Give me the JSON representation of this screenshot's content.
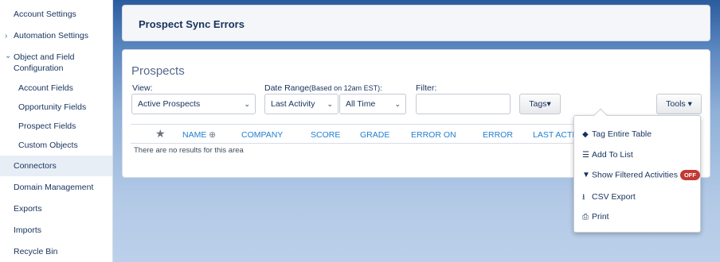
{
  "sidebar": {
    "items": [
      {
        "label": "Account Settings",
        "chevron": ""
      },
      {
        "label": "Automation Settings",
        "chevron": "›"
      },
      {
        "label": "Object and Field",
        "label2": "Configuration",
        "chevron": "⌄"
      },
      {
        "label": "Account Fields"
      },
      {
        "label": "Opportunity Fields"
      },
      {
        "label": "Prospect Fields"
      },
      {
        "label": "Custom Objects"
      },
      {
        "label": "Connectors"
      },
      {
        "label": "Domain Management"
      },
      {
        "label": "Exports"
      },
      {
        "label": "Imports"
      },
      {
        "label": "Recycle Bin"
      }
    ]
  },
  "header": {
    "title": "Prospect Sync Errors"
  },
  "prospects": {
    "title": "Prospects",
    "view_label": "View:",
    "view_value": "Active Prospects",
    "date_range_label": "Date Range",
    "date_range_note": "(Based on 12am EST):",
    "date_field": "Last Activity",
    "date_period": "All Time",
    "filter_label": "Filter:",
    "filter_value": "",
    "tags_button": "Tags▾",
    "tools_button": "Tools ▾"
  },
  "table": {
    "columns": [
      "NAME",
      "COMPANY",
      "SCORE",
      "GRADE",
      "ERROR ON",
      "ERROR",
      "LAST ACTIV"
    ],
    "empty_text": "There are no results for this area"
  },
  "tools_menu": {
    "items": [
      {
        "label": "Tag Entire Table",
        "icon": "tag-icon"
      },
      {
        "label": "Add To List",
        "icon": "list-icon"
      },
      {
        "label": "Show Filtered Activities",
        "icon": "filter-icon",
        "badge": "OFF"
      },
      {
        "label": "CSV Export",
        "icon": "download-icon",
        "highlighted": true
      },
      {
        "label": "Print",
        "icon": "print-icon"
      }
    ]
  },
  "colors": {
    "accent": "#1f7fd2",
    "badge_off": "#c23934",
    "highlight": "#fff200"
  }
}
